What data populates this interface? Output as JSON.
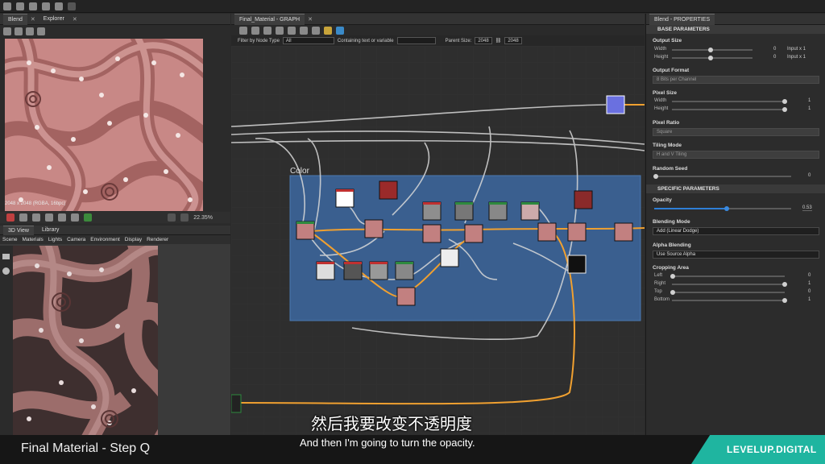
{
  "topbar": {
    "icons": [
      "new-icon",
      "open-icon",
      "save-icon",
      "save-all-icon",
      "undo-icon",
      "redo-icon"
    ]
  },
  "view2d": {
    "tab_active": "Blend",
    "tab_other": "Explorer",
    "resolution": "2048 x 2048 (RGBA, 16bpc)",
    "zoom": "22.35%"
  },
  "view3d": {
    "tabs": [
      "3D View",
      "Library"
    ],
    "menu": [
      "Scene",
      "Materials",
      "Lights",
      "Camera",
      "Environment",
      "Display",
      "Renderer"
    ]
  },
  "graph": {
    "title": "Final_Material - GRAPH",
    "filter_label": "Filter by Node Type",
    "filter_value": "All",
    "contains_label": "Containing text or variable",
    "parent_size_label": "Parent Size:",
    "parent_size_w": "2048",
    "parent_size_h": "2048",
    "frame_label": "Color"
  },
  "props": {
    "title": "Blend - PROPERTIES",
    "base_header": "BASE PARAMETERS",
    "output_size": {
      "label": "Output Size",
      "width_label": "Width",
      "height_label": "Height",
      "width_val": "0",
      "height_val": "0",
      "width_mode": "Input x 1",
      "height_mode": "Input x 1"
    },
    "output_format": {
      "label": "Output Format",
      "value": "8 Bits per Channel"
    },
    "pixel_size": {
      "label": "Pixel Size",
      "width_label": "Width",
      "height_label": "Height",
      "width_val": "1",
      "height_val": "1"
    },
    "pixel_ratio": {
      "label": "Pixel Ratio",
      "value": "Square"
    },
    "tiling_mode": {
      "label": "Tiling Mode",
      "value": "H and V Tiling"
    },
    "random_seed": {
      "label": "Random Seed",
      "value": "0"
    },
    "specific_header": "SPECIFIC PARAMETERS",
    "opacity": {
      "label": "Opacity",
      "value": "0.53",
      "fraction": 0.53
    },
    "blending_mode": {
      "label": "Blending Mode",
      "value": "Add (Linear Dodge)"
    },
    "alpha_blending": {
      "label": "Alpha Blending",
      "value": "Use Source Alpha"
    },
    "cropping": {
      "label": "Cropping Area",
      "left_label": "Left",
      "right_label": "Right",
      "top_label": "Top",
      "bottom_label": "Bottom",
      "left_val": "0",
      "right_val": "1",
      "top_val": "0",
      "bottom_val": "1"
    }
  },
  "captions": {
    "title": "Final Material - Step Q",
    "subtitle_cn": "然后我要改变不透明度",
    "subtitle_en": "And then I'm going to turn the opacity.",
    "brand": "LEVELUP.DIGITAL"
  },
  "colors": {
    "accent_blue": "#2f7fd6",
    "frame_blue": "#3a5f8f",
    "wire_orange": "#f0a030",
    "brand_teal": "#1fb5a0"
  }
}
